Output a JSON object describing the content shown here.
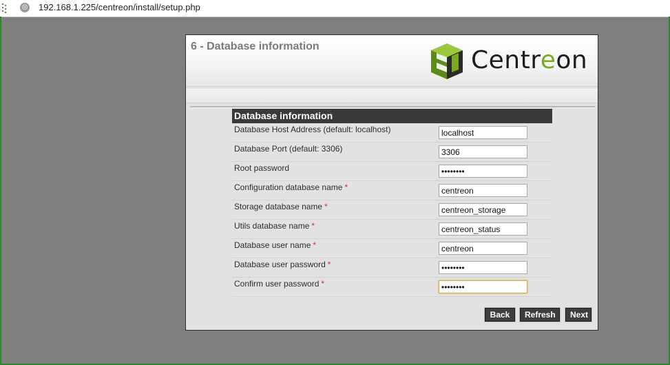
{
  "browser": {
    "url": "192.168.1.225/centreon/install/setup.php"
  },
  "panel": {
    "step_title": "6 - Database information",
    "logo_text_prefix": "Centr",
    "logo_text_accent": "e",
    "logo_text_suffix": "on"
  },
  "form": {
    "heading": "Database information",
    "rows": [
      {
        "label": "Database Host Address (default: localhost)",
        "required": "",
        "value": "localhost",
        "type": "text"
      },
      {
        "label": "Database Port (default: 3306)",
        "required": "",
        "value": "3306",
        "type": "text"
      },
      {
        "label": "Root password",
        "required": "",
        "value": "••••••••",
        "type": "password"
      },
      {
        "label": "Configuration database name",
        "required": "*",
        "value": "centreon",
        "type": "text"
      },
      {
        "label": "Storage database name",
        "required": "*",
        "value": "centreon_storage",
        "type": "text"
      },
      {
        "label": "Utils database name",
        "required": "*",
        "value": "centreon_status",
        "type": "text"
      },
      {
        "label": "Database user name",
        "required": "*",
        "value": "centreon",
        "type": "text"
      },
      {
        "label": "Database user password",
        "required": "*",
        "value": "••••••••",
        "type": "password"
      },
      {
        "label": "Confirm user password",
        "required": "*",
        "value": "••••••••",
        "type": "password"
      }
    ]
  },
  "buttons": {
    "back": "Back",
    "refresh": "Refresh",
    "next": "Next"
  },
  "icons": {
    "globe": "globe-icon",
    "logo": "centreon-logo-icon"
  },
  "colors": {
    "brand_green": "#7aaa22",
    "required_star": "#d03030",
    "header_bar": "#3a3a3a",
    "focus_border": "#e6a33b"
  }
}
